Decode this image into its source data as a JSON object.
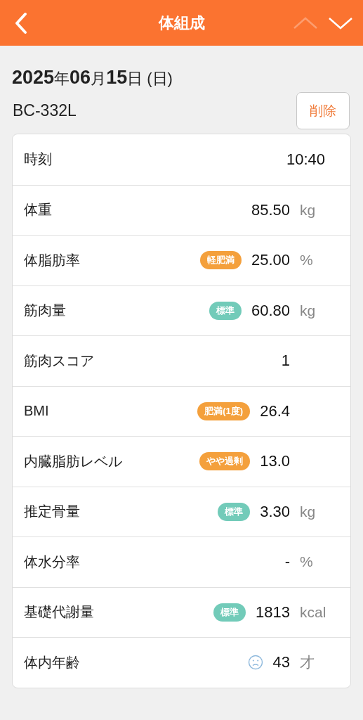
{
  "header": {
    "title": "体組成",
    "prev_disabled": true,
    "next_disabled": false
  },
  "date": "**2025**年**06**月**15**日 (日)",
  "device": "BC-332L",
  "delete_button": "削除",
  "rows": [
    {
      "kind": "time",
      "label": "時刻",
      "value": "10:40"
    },
    {
      "kind": "measure",
      "label": "体重",
      "value": "85.50",
      "unit": "kg"
    },
    {
      "kind": "measure",
      "label": "体脂肪率",
      "badge": {
        "text": "軽肥満",
        "color": "#f4a03c"
      },
      "value": "25.00",
      "unit": "%"
    },
    {
      "kind": "measure",
      "label": "筋肉量",
      "badge": {
        "text": "標準",
        "color": "#72cbb9"
      },
      "value": "60.80",
      "unit": "kg"
    },
    {
      "kind": "measure",
      "label": "筋肉スコア",
      "value": "1"
    },
    {
      "kind": "measure",
      "label": "BMI",
      "badge": {
        "text": "肥満(1度)",
        "color": "#f4a03c"
      },
      "value": "26.4"
    },
    {
      "kind": "measure",
      "label": "内臓脂肪レベル",
      "badge": {
        "text": "やや過剰",
        "color": "#f4a03c"
      },
      "value": "13.0"
    },
    {
      "kind": "measure",
      "label": "推定骨量",
      "badge": {
        "text": "標準",
        "color": "#72cbb9"
      },
      "value": "3.30",
      "unit": "kg"
    },
    {
      "kind": "measure",
      "label": "体水分率",
      "value": "-",
      "unit": "%"
    },
    {
      "kind": "measure",
      "label": "基礎代謝量",
      "badge": {
        "text": "標準",
        "color": "#72cbb9"
      },
      "value": "1813",
      "unit": "kcal"
    },
    {
      "kind": "age",
      "label": "体内年齢",
      "value": "43",
      "unit": "才"
    }
  ]
}
